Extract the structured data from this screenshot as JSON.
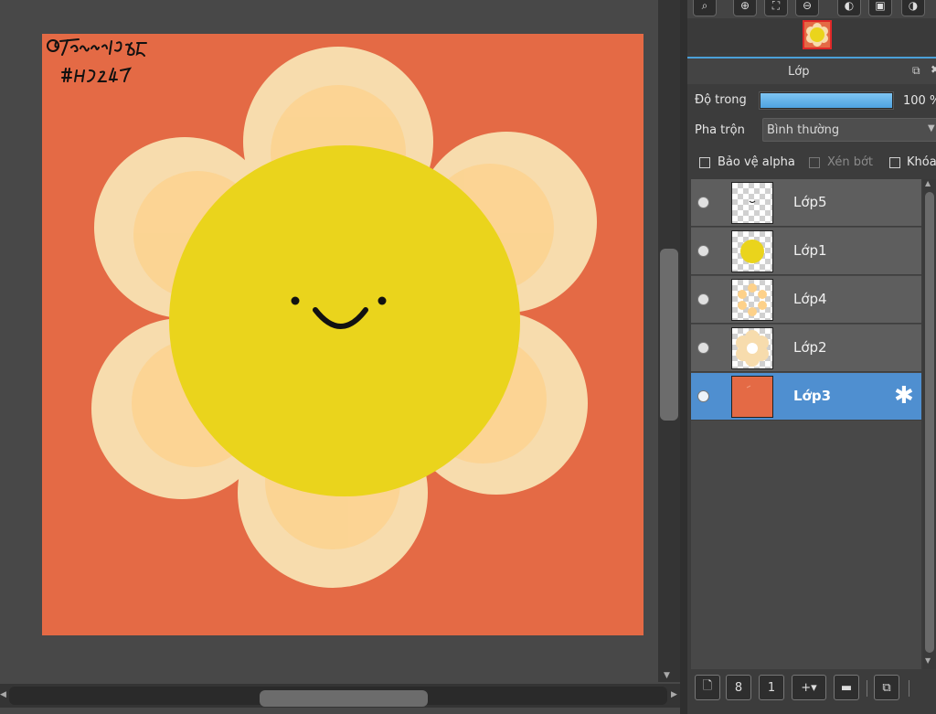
{
  "canvas": {
    "signature_text": "@Tanmia1985 #HD247",
    "colors": {
      "background": "#e46a45",
      "petal_outer": "#f7dcad",
      "petal_inner": "#fdd18a",
      "center": "#ead41c",
      "face": "#111111"
    }
  },
  "nav_toolbar": {
    "buttons": [
      "zoom-fit-icon",
      "zoom-in-icon",
      "fit-screen-icon",
      "zoom-out-icon",
      "rotate-left-icon",
      "flip-icon",
      "rotate-right-icon"
    ]
  },
  "layer_panel": {
    "title": "Lớp",
    "opacity_label": "Độ trong",
    "opacity_value": "100 %",
    "opacity_fraction": 1.0,
    "blend_label": "Pha trộn",
    "blend_value": "Bình thường",
    "protect_alpha_label": "Bảo vệ alpha",
    "clipping_label": "Xén bớt",
    "lock_label": "Khóa"
  },
  "layers": [
    {
      "name": "Lớp5",
      "thumb": "face"
    },
    {
      "name": "Lớp1",
      "thumb": "circle"
    },
    {
      "name": "Lớp4",
      "thumb": "inner-petals"
    },
    {
      "name": "Lớp2",
      "thumb": "petals"
    },
    {
      "name": "Lớp3",
      "thumb": "background",
      "selected": true
    }
  ],
  "bottom_toolbar": {
    "buttons": [
      "new-layer-icon",
      "new-8bit-layer-icon",
      "new-1bit-layer-icon",
      "add-layer-dropdown-icon",
      "new-folder-icon",
      "duplicate-layer-icon"
    ]
  }
}
